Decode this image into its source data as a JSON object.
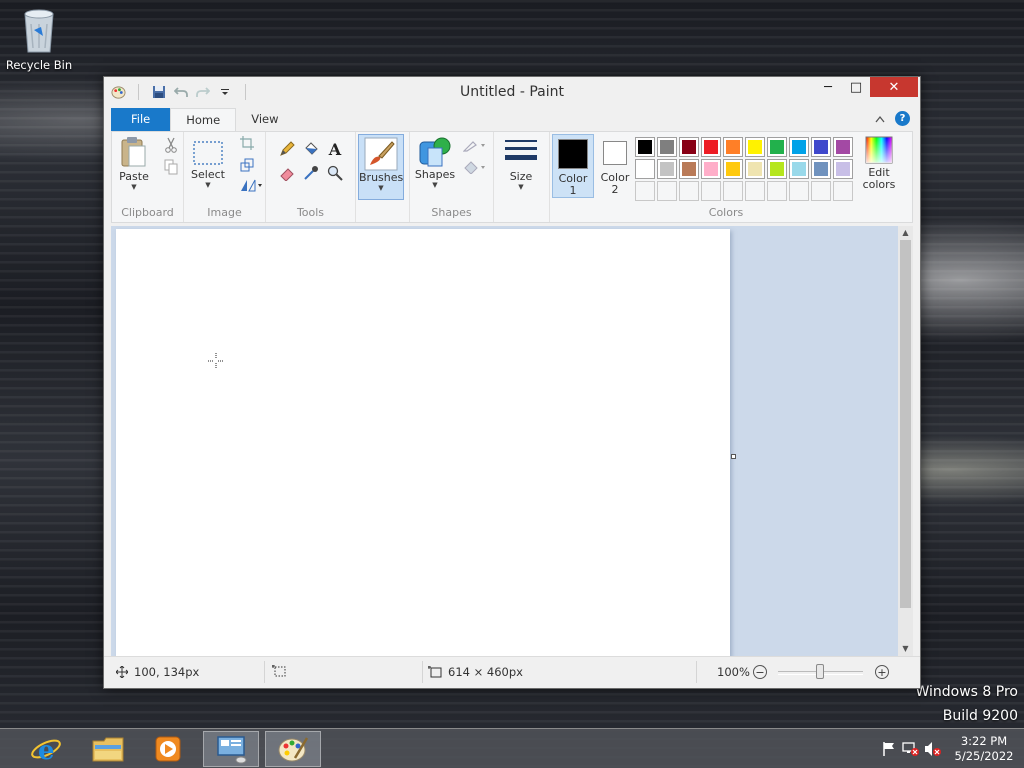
{
  "desktop": {
    "recycle_bin_label": "Recycle Bin",
    "watermark_line1": "Windows 8 Pro",
    "watermark_line2": "Build 9200"
  },
  "window": {
    "title": "Untitled - Paint",
    "controls": {
      "minimize": "─",
      "maximize": "□",
      "close": "✕"
    }
  },
  "tabs": {
    "file": "File",
    "home": "Home",
    "view": "View"
  },
  "ribbon": {
    "clipboard": {
      "label": "Clipboard",
      "paste": "Paste"
    },
    "image": {
      "label": "Image",
      "select": "Select"
    },
    "tools": {
      "label": "Tools"
    },
    "brushes": {
      "label": "Brushes"
    },
    "shapes": {
      "label": "Shapes",
      "shapes_btn": "Shapes"
    },
    "size": {
      "label": "Size"
    },
    "colors": {
      "label": "Colors",
      "color1_line1": "Color",
      "color1_line2": "1",
      "color2_line1": "Color",
      "color2_line2": "2",
      "edit_line1": "Edit",
      "edit_line2": "colors",
      "color1_value": "#000000",
      "color2_value": "#ffffff",
      "palette": [
        "#000000",
        "#7f7f7f",
        "#880015",
        "#ed1c24",
        "#ff7f27",
        "#fff200",
        "#22b14c",
        "#00a2e8",
        "#3f48cc",
        "#a349a4",
        "#ffffff",
        "#c3c3c3",
        "#b97a57",
        "#ffaec9",
        "#ffc90e",
        "#efe4b0",
        "#b5e61d",
        "#99d9ea",
        "#7092be",
        "#c8bfe7"
      ],
      "empty_slots": 10
    }
  },
  "status": {
    "cursor_pos": "100, 134px",
    "selection_size": "",
    "canvas_size": "614 × 460px",
    "zoom": "100%"
  },
  "taskbar": {
    "clock_time": "3:22 PM",
    "clock_date": "5/25/2022"
  }
}
